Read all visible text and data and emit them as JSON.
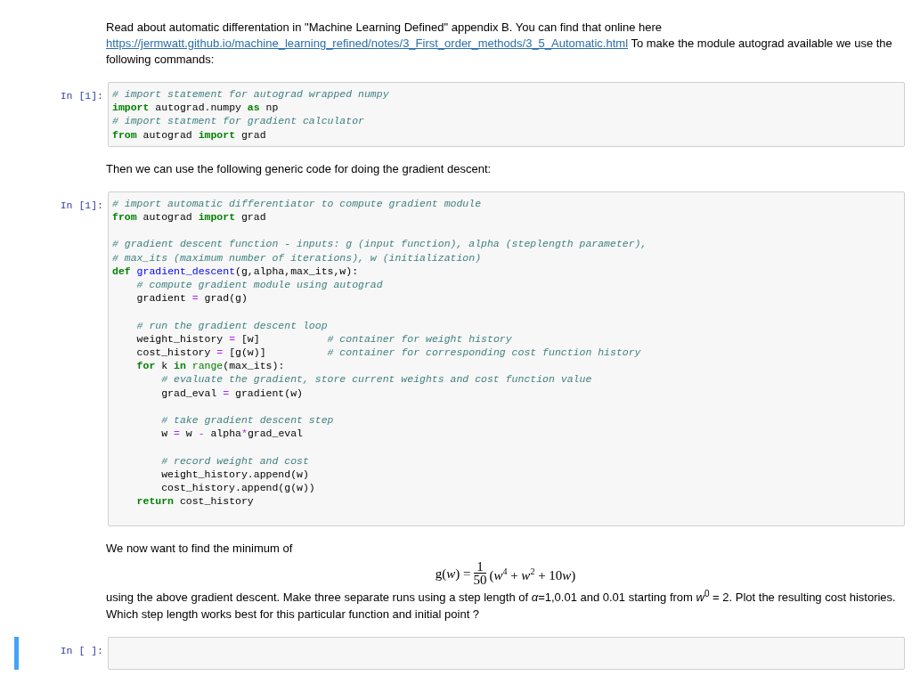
{
  "cells": [
    {
      "kind": "markdown",
      "selected": false,
      "blocks": [
        {
          "kind": "para",
          "text": "Read about automatic differentation in \"Machine Learning Defined\" appendix B. You can find that online here ",
          "link": "https://jermwatt.github.io/machine_learning_refined/notes/3_First_order_methods/3_5_Automatic.html",
          "after": " To make the module autograd available we use the following commands:"
        }
      ]
    },
    {
      "kind": "code",
      "selected": false,
      "prompt": "In [1]:",
      "groups": [
        [
          [
            {
              "kind": "comment",
              "text": "# import statement for autograd wrapped numpy"
            }
          ],
          [
            {
              "kind": "keyword",
              "text": "import"
            },
            {
              "kind": "plain",
              "text": " autograd.numpy "
            },
            {
              "kind": "keyword",
              "text": "as"
            },
            {
              "kind": "plain",
              "text": " np"
            }
          ],
          [
            {
              "kind": "comment",
              "text": "# import statment for gradient calculator"
            }
          ],
          [
            {
              "kind": "keyword",
              "text": "from"
            },
            {
              "kind": "plain",
              "text": " autograd "
            },
            {
              "kind": "keyword",
              "text": "import"
            },
            {
              "kind": "plain",
              "text": " grad"
            }
          ]
        ]
      ]
    },
    {
      "kind": "markdown",
      "selected": false,
      "blocks": [
        {
          "kind": "para",
          "text": "Then we can use the following generic code for doing the gradient descent:"
        }
      ]
    },
    {
      "kind": "code",
      "selected": false,
      "prompt": "In [1]:",
      "groups": [
        [
          [
            {
              "kind": "comment",
              "text": "# import automatic differentiator to compute gradient module"
            }
          ],
          [
            {
              "kind": "keyword",
              "text": "from"
            },
            {
              "kind": "plain",
              "text": " autograd "
            },
            {
              "kind": "keyword",
              "text": "import"
            },
            {
              "kind": "plain",
              "text": " grad"
            }
          ]
        ],
        [
          [
            {
              "kind": "comment",
              "text": "# gradient descent function - inputs: g (input function), alpha (steplength parameter),"
            }
          ],
          [
            {
              "kind": "comment",
              "text": "# max_its (maximum number of iterations), w (initialization)"
            }
          ],
          [
            {
              "kind": "keyword",
              "text": "def"
            },
            {
              "kind": "name",
              "text": " gradient_descent"
            },
            {
              "kind": "plain",
              "text": "(g,alpha,max_its,w):"
            }
          ],
          [
            {
              "kind": "comment",
              "text": "    # compute gradient module using autograd"
            }
          ],
          [
            {
              "kind": "plain",
              "text": "    gradient "
            },
            {
              "kind": "operator",
              "text": "="
            },
            {
              "kind": "plain",
              "text": " grad(g)"
            }
          ]
        ],
        [
          [
            {
              "kind": "comment",
              "text": "    # run the gradient descent loop"
            }
          ],
          [
            {
              "kind": "plain",
              "text": "    weight_history "
            },
            {
              "kind": "operator",
              "text": "="
            },
            {
              "kind": "plain",
              "text": " [w]           "
            },
            {
              "kind": "comment",
              "text": "# container for weight history"
            }
          ],
          [
            {
              "kind": "plain",
              "text": "    cost_history "
            },
            {
              "kind": "operator",
              "text": "="
            },
            {
              "kind": "plain",
              "text": " [g(w)]          "
            },
            {
              "kind": "comment",
              "text": "# container for corresponding cost function history"
            }
          ],
          [
            {
              "kind": "keyword",
              "text": "    for"
            },
            {
              "kind": "plain",
              "text": " k "
            },
            {
              "kind": "keyword",
              "text": "in"
            },
            {
              "kind": "builtin",
              "text": " range"
            },
            {
              "kind": "plain",
              "text": "(max_its):"
            }
          ],
          [
            {
              "kind": "comment",
              "text": "        # evaluate the gradient, store current weights and cost function value"
            }
          ],
          [
            {
              "kind": "plain",
              "text": "        grad_eval "
            },
            {
              "kind": "operator",
              "text": "="
            },
            {
              "kind": "plain",
              "text": " gradient(w)"
            }
          ]
        ],
        [
          [
            {
              "kind": "comment",
              "text": "        # take gradient descent step"
            }
          ],
          [
            {
              "kind": "plain",
              "text": "        w "
            },
            {
              "kind": "operator",
              "text": "="
            },
            {
              "kind": "plain",
              "text": " w "
            },
            {
              "kind": "operator",
              "text": "-"
            },
            {
              "kind": "plain",
              "text": " alpha"
            },
            {
              "kind": "operator",
              "text": "*"
            },
            {
              "kind": "plain",
              "text": "grad_eval"
            }
          ]
        ],
        [
          [
            {
              "kind": "comment",
              "text": "        # record weight and cost"
            }
          ],
          [
            {
              "kind": "plain",
              "text": "        weight_history.append(w)"
            }
          ],
          [
            {
              "kind": "plain",
              "text": "        cost_history.append(g(w))"
            }
          ],
          [
            {
              "kind": "keyword",
              "text": "    return"
            },
            {
              "kind": "plain",
              "text": " cost_history"
            }
          ]
        ]
      ]
    },
    {
      "kind": "markdown",
      "selected": false,
      "blocks": [
        {
          "kind": "para",
          "text": "We now want to find the minimum of"
        },
        {
          "kind": "formula",
          "lhs": "g(*w*) =",
          "numerator": "1",
          "denominator": "50",
          "rhs": [
            "(*w*$^{4}$ + *w*$^{2}$ + 10",
            "*w*",
            ")"
          ]
        },
        {
          "kind": "para",
          "text": "using the above gradient descent. Make three separate runs using a step length of *α*=1,0.01 and 0.01 starting from *w*$^{0}$ = 2. Plot the resulting cost histories. Which step length works best for this particular function and initial point ?"
        }
      ]
    },
    {
      "kind": "code",
      "selected": true,
      "prompt": "In [ ]:"
    }
  ]
}
